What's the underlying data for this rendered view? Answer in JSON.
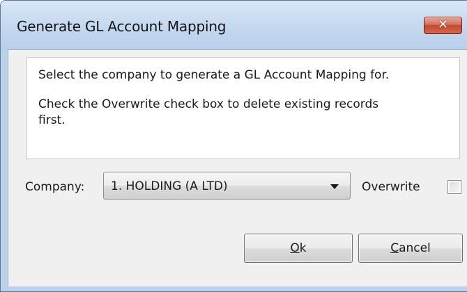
{
  "window": {
    "title": "Generate GL Account Mapping",
    "close_icon": "close-icon"
  },
  "message": {
    "line1": "Select the company to generate a GL Account Mapping for.",
    "line2": "Check the Overwrite check box to delete existing records",
    "line3": "first."
  },
  "company": {
    "label": "Company:",
    "selected": "1. HOLDING (A LTD)"
  },
  "overwrite": {
    "label": "Overwrite",
    "checked": false
  },
  "buttons": {
    "ok_mnemonic": "O",
    "ok_rest": "k",
    "cancel_mnemonic": "C",
    "cancel_rest": "ancel"
  }
}
